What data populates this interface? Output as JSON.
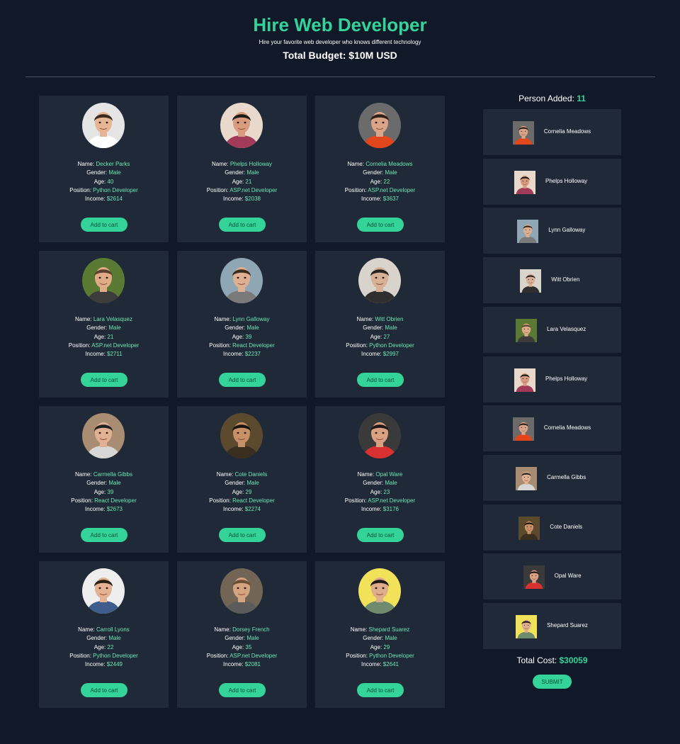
{
  "header": {
    "title": "Hire Web Developer",
    "subtitle": "Hire your favorite web developer who knows different technology",
    "budget": "Total Budget: $10M USD"
  },
  "labels": {
    "name": "Name: ",
    "gender": "Gender: ",
    "age": "Age: ",
    "position": "Position: ",
    "income": "Income: "
  },
  "add_button_label": "Add to cart",
  "developers": [
    {
      "name": "Decker Parks",
      "gender": "Male",
      "age": "40",
      "position": "Python Developer",
      "income": "$2614",
      "avatar": {
        "bg": "#e5e5e5",
        "skin": "#e6b594",
        "hair": "#3a2a1f",
        "shirt": "#ffffff"
      }
    },
    {
      "name": "Phelps Holloway",
      "gender": "Male",
      "age": "21",
      "position": "ASP.net Developer",
      "income": "$2038",
      "avatar": {
        "bg": "#e8d9cc",
        "skin": "#d89b7e",
        "hair": "#1e1a18",
        "shirt": "#a23a5a"
      }
    },
    {
      "name": "Cornelia Meadows",
      "gender": "Male",
      "age": "22",
      "position": "ASP.net Developer",
      "income": "$3637",
      "avatar": {
        "bg": "#6b6b6b",
        "skin": "#d9a487",
        "hair": "#2d2018",
        "shirt": "#e2461b"
      }
    },
    {
      "name": "Lara Velasquez",
      "gender": "Male",
      "age": "21",
      "position": "ASP.net Developer",
      "income": "$2711",
      "avatar": {
        "bg": "#5a7a34",
        "skin": "#e0ab87",
        "hair": "#5a4030",
        "shirt": "#3c3c3c"
      }
    },
    {
      "name": "Lynn Galloway",
      "gender": "Male",
      "age": "39",
      "position": "React Developer",
      "income": "$2237",
      "avatar": {
        "bg": "#8fa7b5",
        "skin": "#ddb092",
        "hair": "#3b2a1e",
        "shirt": "#7a7a7a"
      }
    },
    {
      "name": "Witt Obrien",
      "gender": "Male",
      "age": "27",
      "position": "Python Developer",
      "income": "$2997",
      "avatar": {
        "bg": "#d8d4cc",
        "skin": "#d7b095",
        "hair": "#2a2420",
        "shirt": "#2f2f2f"
      }
    },
    {
      "name": "Carmella Gibbs",
      "gender": "Male",
      "age": "39",
      "position": "React Developer",
      "income": "$2673",
      "avatar": {
        "bg": "#a88d72",
        "skin": "#e2b193",
        "hair": "#222222",
        "shirt": "#d7d7d7"
      }
    },
    {
      "name": "Cote Daniels",
      "gender": "Male",
      "age": "29",
      "position": "React Developer",
      "income": "$2274",
      "avatar": {
        "bg": "#5c4a2e",
        "skin": "#c89066",
        "hair": "#1a1410",
        "shirt": "#3a2e20"
      }
    },
    {
      "name": "Opal Ware",
      "gender": "Male",
      "age": "23",
      "position": "ASP.net Developer",
      "income": "$3176",
      "avatar": {
        "bg": "#3a3a3a",
        "skin": "#d9a181",
        "hair": "#1f1814",
        "shirt": "#d73131"
      }
    },
    {
      "name": "Carroll Lyons",
      "gender": "Male",
      "age": "22",
      "position": "Python Developer",
      "income": "$2449",
      "avatar": {
        "bg": "#eeeeee",
        "skin": "#e4b292",
        "hair": "#2a1f18",
        "shirt": "#3f5d8c"
      }
    },
    {
      "name": "Dorsey French",
      "gender": "Male",
      "age": "35",
      "position": "ASP.net Developer",
      "income": "$2081",
      "avatar": {
        "bg": "#736556",
        "skin": "#d4a481",
        "hair": "#6b4e36",
        "shirt": "#5b5b5b"
      }
    },
    {
      "name": "Shepard Suarez",
      "gender": "Male",
      "age": "29",
      "position": "Python Developer",
      "income": "$2641",
      "avatar": {
        "bg": "#f2e25a",
        "skin": "#deae8c",
        "hair": "#211a16",
        "shirt": "#6e8b6f"
      }
    }
  ],
  "sidebar": {
    "person_added_label": "Person Added: ",
    "person_added_count": "11",
    "added": [
      {
        "name": "Cornelia Meadows",
        "avatar": {
          "bg": "#6b6b6b",
          "skin": "#d9a487",
          "hair": "#2d2018",
          "shirt": "#e2461b"
        }
      },
      {
        "name": "Phelps Holloway",
        "avatar": {
          "bg": "#e8d9cc",
          "skin": "#d89b7e",
          "hair": "#1e1a18",
          "shirt": "#a23a5a"
        }
      },
      {
        "name": "Lynn Galloway",
        "avatar": {
          "bg": "#8fa7b5",
          "skin": "#ddb092",
          "hair": "#3b2a1e",
          "shirt": "#7a7a7a"
        }
      },
      {
        "name": "Witt Obrien",
        "avatar": {
          "bg": "#d8d4cc",
          "skin": "#d7b095",
          "hair": "#2a2420",
          "shirt": "#2f2f2f"
        }
      },
      {
        "name": "Lara Velasquez",
        "avatar": {
          "bg": "#5a7a34",
          "skin": "#e0ab87",
          "hair": "#5a4030",
          "shirt": "#3c3c3c"
        }
      },
      {
        "name": "Phelps Holloway",
        "avatar": {
          "bg": "#e8d9cc",
          "skin": "#d89b7e",
          "hair": "#1e1a18",
          "shirt": "#a23a5a"
        }
      },
      {
        "name": "Cornelia Meadows",
        "avatar": {
          "bg": "#6b6b6b",
          "skin": "#d9a487",
          "hair": "#2d2018",
          "shirt": "#e2461b"
        }
      },
      {
        "name": "Carmella Gibbs",
        "avatar": {
          "bg": "#a88d72",
          "skin": "#e2b193",
          "hair": "#222222",
          "shirt": "#d7d7d7"
        }
      },
      {
        "name": "Cote Daniels",
        "avatar": {
          "bg": "#5c4a2e",
          "skin": "#c89066",
          "hair": "#1a1410",
          "shirt": "#3a2e20"
        }
      },
      {
        "name": "Opal Ware",
        "avatar": {
          "bg": "#3a3a3a",
          "skin": "#d9a181",
          "hair": "#1f1814",
          "shirt": "#d73131"
        }
      },
      {
        "name": "Shepard Suarez",
        "avatar": {
          "bg": "#f2e25a",
          "skin": "#deae8c",
          "hair": "#211a16",
          "shirt": "#6e8b6f"
        }
      }
    ],
    "total_cost_label": "Total Cost: ",
    "total_cost_value": "$30059",
    "submit_label": "SUBMIT"
  },
  "colors": {
    "background": "#111827",
    "card": "#1f2937",
    "accent": "#34d399",
    "value_text": "#6ee7b7"
  }
}
